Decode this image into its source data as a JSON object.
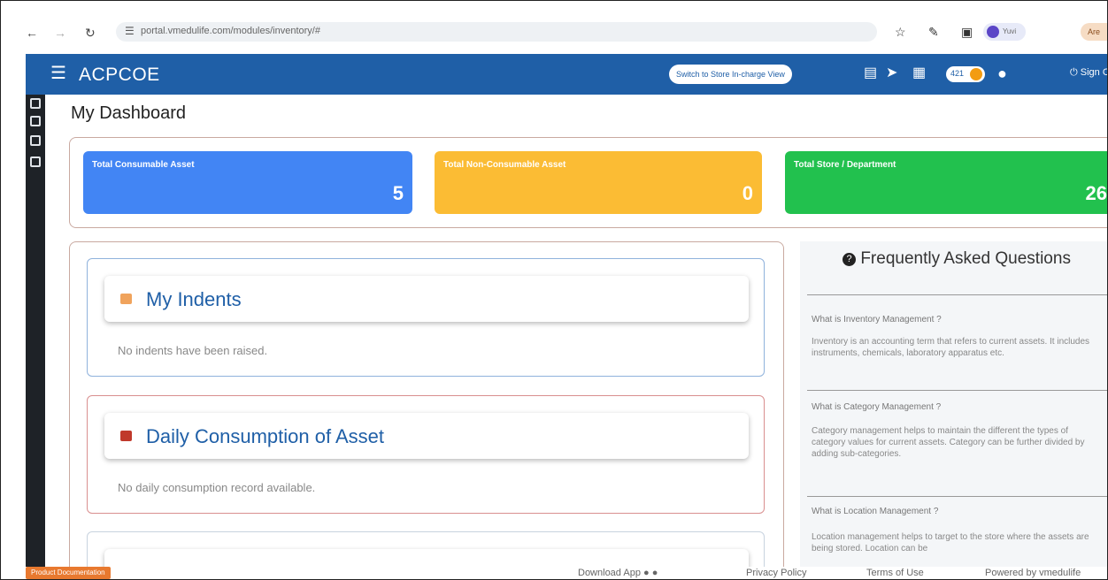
{
  "browser": {
    "back_icon": "arrow-left-icon",
    "forward_icon": "arrow-right-icon",
    "reload_icon": "reload-icon",
    "url": "portal.vmedulife.com/modules/inventory/#",
    "profile_name": "Yuvi",
    "ext_label": "Are"
  },
  "header": {
    "brand": "ACPCOE",
    "switch_label": "Switch to Store In-charge View",
    "coin_count": "421",
    "signout_label": "Sign Out",
    "color": "#1f5fa7"
  },
  "page": {
    "title": "My Dashboard"
  },
  "stats": [
    {
      "label": "Total Consumable Asset",
      "value": "5",
      "color": "#4285f4"
    },
    {
      "label": "Total Non-Consumable Asset",
      "value": "0",
      "color": "#fbbc34"
    },
    {
      "label": "Total Store / Department",
      "value": "26",
      "color": "#22c14e"
    }
  ],
  "sections": {
    "indents": {
      "title": "My Indents",
      "empty": "No indents have been raised."
    },
    "consumption": {
      "title": "Daily Consumption of Asset",
      "empty": "No daily consumption record available."
    },
    "third": {
      "title": ""
    }
  },
  "faq": {
    "title": "Frequently Asked Questions",
    "items": [
      {
        "q": "What is Inventory Management ?",
        "a": "Inventory is an accounting term that refers to current assets. It includes instruments, chemicals, laboratory apparatus etc."
      },
      {
        "q": "What is Category Management ?",
        "a": "Category management helps to maintain the different the types of category values for current assets. Category can be further divided by adding sub-categories."
      },
      {
        "q": "What is Location Management ?",
        "a": "Location management helps to target to the store where the assets are being stored. Location can be"
      }
    ]
  },
  "footer": {
    "doc_label": "Product Documentation",
    "download": "Download App",
    "privacy": "Privacy Policy",
    "terms": "Terms of Use",
    "powered": "Powered by vmedulife"
  }
}
